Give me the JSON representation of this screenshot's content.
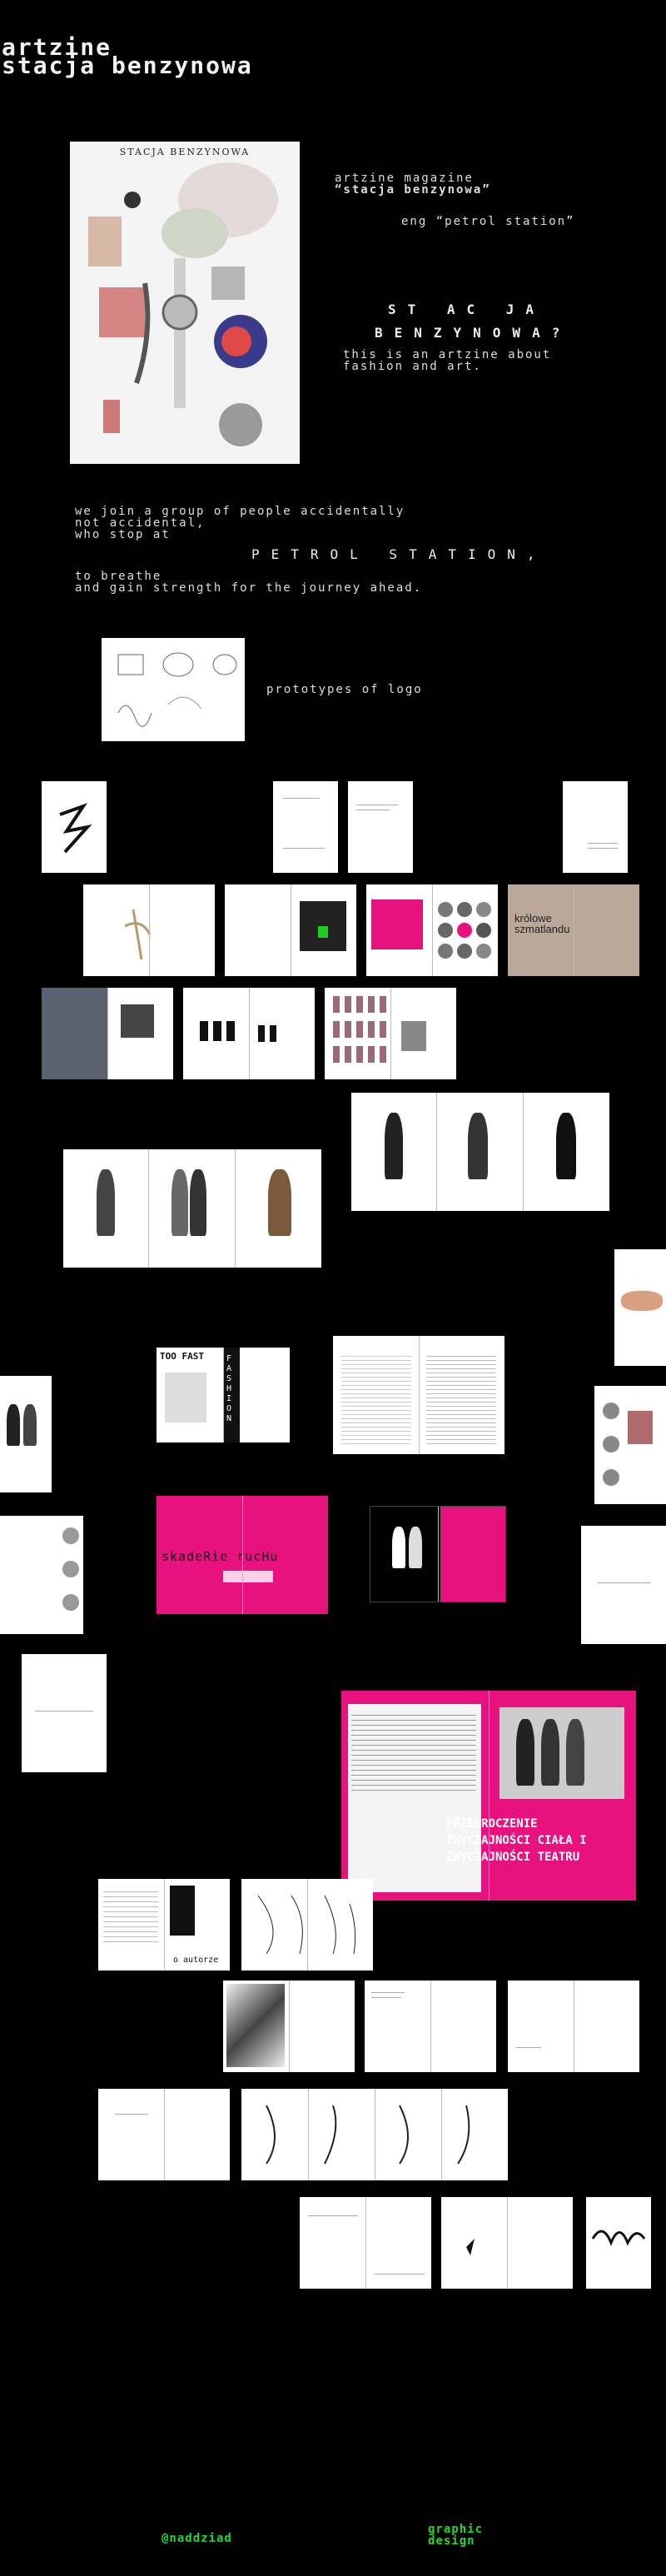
{
  "site": {
    "title_line1": "artzine",
    "title_line2": "stacja benzynowa"
  },
  "cover": {
    "title": "STACJA BENZYNOWA"
  },
  "intro": {
    "line1": "artzine magazine",
    "line2": "“stacja benzynowa”",
    "line3": "eng “petrol station”",
    "question_line1": "ST  AC  JA",
    "question_line2": "BENZYNOWA?",
    "about_line1": "this is an artzine about",
    "about_line2": "fashion and art."
  },
  "manifesto": {
    "line1": "we join a group of people accidentally",
    "line2": "not accidental,",
    "line3": "who stop at",
    "line4": "PETROL STATION,",
    "line5": "to breathe",
    "line6": "and gain strength for the journey ahead."
  },
  "logo": {
    "caption": "prototypes of logo"
  },
  "spreads": {
    "fashion_word": "FASHION",
    "too_fast": "TOO FAST",
    "skaderie": "skadeRie rucHu",
    "krolowe": "królowe szmatlandu",
    "przekroczenie": "PRZEKROCZENIE ZWYCZAJNOŚCI CIAŁA I ZWYCZAJNOŚCI TEATRU",
    "o_autorze": "o autorze"
  },
  "footer": {
    "handle": "@naddziad",
    "category_line1": "graphic",
    "category_line2": "design"
  },
  "colors": {
    "background": "#000000",
    "accent_pink": "#e8127f",
    "footer_green": "#22d82c"
  }
}
